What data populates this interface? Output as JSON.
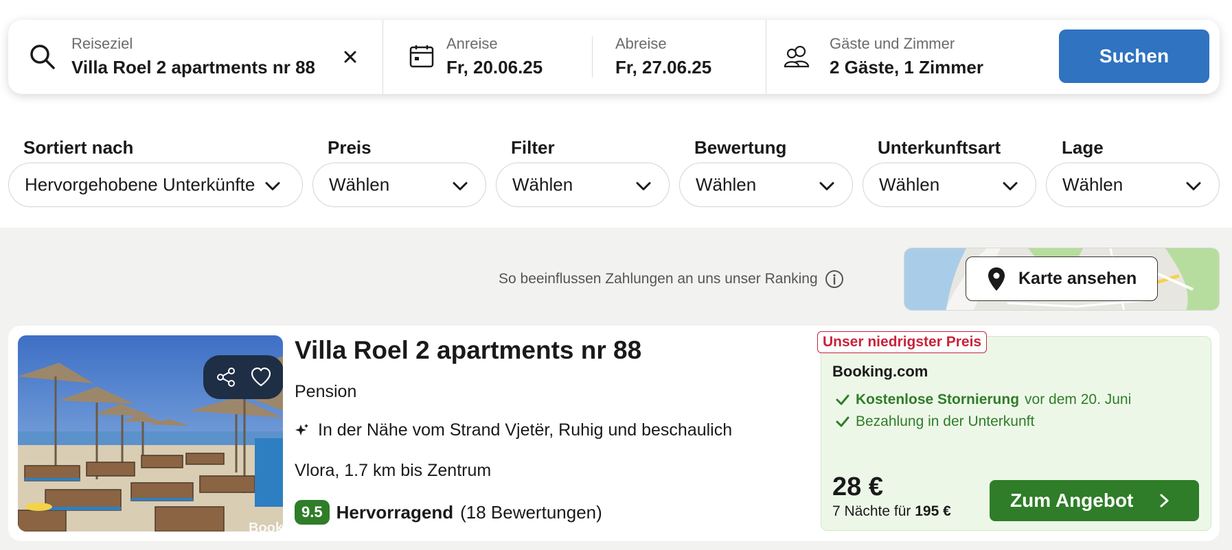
{
  "search": {
    "destination_label": "Reiseziel",
    "destination_value": "Villa Roel 2 apartments nr 88",
    "checkin_label": "Anreise",
    "checkin_value": "Fr, 20.06.25",
    "checkout_label": "Abreise",
    "checkout_value": "Fr, 27.06.25",
    "guests_label": "Gäste und Zimmer",
    "guests_value": "2 Gäste, 1 Zimmer",
    "search_button": "Suchen",
    "icons": [
      "search-icon",
      "clear-icon",
      "calendar-icon",
      "guests-icon"
    ]
  },
  "filters": [
    {
      "label": "Sortiert nach",
      "value": "Hervorgehobene Unterkünfte"
    },
    {
      "label": "Preis",
      "value": "Wählen"
    },
    {
      "label": "Filter",
      "value": "Wählen"
    },
    {
      "label": "Bewertung",
      "value": "Wählen"
    },
    {
      "label": "Unterkunftsart",
      "value": "Wählen"
    },
    {
      "label": "Lage",
      "value": "Wählen"
    }
  ],
  "ranking_note": "So beeinflussen Zahlungen an uns unser Ranking",
  "map": {
    "button_label": "Karte ansehen"
  },
  "result": {
    "title": "Villa Roel 2 apartments nr 88",
    "type": "Pension",
    "highlights": "In der Nähe vom Strand Vjetër, Ruhig und beschaulich",
    "location": "Vlora, 1.7 km bis Zentrum",
    "score": "9.5",
    "rating_word": "Hervorragend",
    "review_count": "(18 Bewertungen)",
    "photo_watermark": "Bookin",
    "offer": {
      "badge": "Unser niedrigster Preis",
      "provider": "Booking.com",
      "perk1_bold": "Kostenlose Stornierung",
      "perk1_rest": "vor dem 20. Juni",
      "perk2": "Bezahlung in der Unterkunft",
      "price": "28 €",
      "total_prefix": "7 Nächte für",
      "total_value": "195 €",
      "cta": "Zum Angebot"
    }
  },
  "colors": {
    "accent_blue": "#2f73c1",
    "green": "#2f7d28",
    "badge_red": "#c8233a",
    "offer_bg": "#edf7e8"
  }
}
